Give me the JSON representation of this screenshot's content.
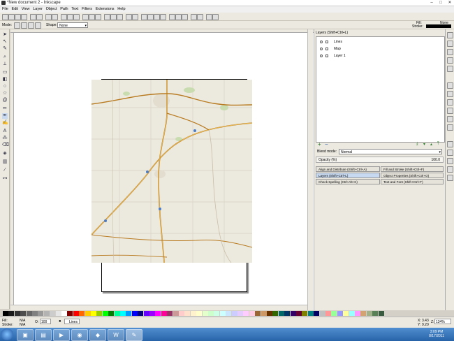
{
  "window": {
    "title": "*New document 2 - Inkscape"
  },
  "menu": [
    "File",
    "Edit",
    "View",
    "Layer",
    "Object",
    "Path",
    "Text",
    "Filters",
    "Extensions",
    "Help"
  ],
  "controls": {
    "mode_label": "Mode:",
    "shape_label": "Shape:",
    "shape_value": "None"
  },
  "fill_stroke": {
    "fill_label": "Fill:",
    "fill_value": "None",
    "stroke_label": "Stroke:"
  },
  "layers_panel": {
    "title": "Layers (Shift+Ctrl+L)",
    "layers": [
      {
        "name": "Lines"
      },
      {
        "name": "Map"
      },
      {
        "name": "Layer 1"
      }
    ],
    "blend_label": "Blend mode:",
    "blend_value": "Normal",
    "opacity_label": "Opacity (%)",
    "opacity_value": "100.0"
  },
  "docks": [
    "Align and Distribute (Shift+Ctrl+A)",
    "Fill and Stroke (Shift+Ctrl+F)",
    "Layers (Shift+Ctrl+L)",
    "Object Properties (Shift+Ctrl+O)",
    "Check Spelling (Ctrl+Alt+K)",
    "Text and Font (Shift+Ctrl+T)"
  ],
  "status": {
    "fill_label": "Fill:",
    "fill_value": "N/A",
    "stroke_label": "Stroke:",
    "stroke_value": "N/A",
    "opacity_label": "O:",
    "opacity_value": "100",
    "layer_value": "Lines",
    "x_label": "X:",
    "x_value": "3.43",
    "y_label": "Y:",
    "y_value": "9.20",
    "zoom_label": "Z:",
    "zoom_value": "134%"
  },
  "clock": {
    "time": "3:09 PM",
    "date": "8/17/2011"
  },
  "palette_colors": [
    "#000000",
    "#1a1a1a",
    "#333333",
    "#4d4d4d",
    "#666666",
    "#808080",
    "#999999",
    "#b3b3b3",
    "#cccccc",
    "#e6e6e6",
    "#ffffff",
    "#800000",
    "#ff0000",
    "#ff6600",
    "#ffcc00",
    "#ffff00",
    "#99cc00",
    "#00ff00",
    "#008000",
    "#00ff99",
    "#00ffff",
    "#0099ff",
    "#0000ff",
    "#000080",
    "#6600ff",
    "#9900ff",
    "#ff00ff",
    "#ff0099",
    "#993366",
    "#cc9999",
    "#ffcccc",
    "#ffe0cc",
    "#fff2cc",
    "#ffffcc",
    "#e5ffcc",
    "#ccffcc",
    "#ccffe5",
    "#ccffff",
    "#cce5ff",
    "#ccccff",
    "#e5ccff",
    "#ffccff",
    "#ffcce5",
    "#996633",
    "#cc9966",
    "#663300",
    "#336600",
    "#006666",
    "#003366",
    "#330066",
    "#660033",
    "#808000",
    "#008080",
    "#000066",
    "#c0c0c0",
    "#ff9999",
    "#99ff99",
    "#9999ff",
    "#ffff99",
    "#99ffff",
    "#ff99ff",
    "#d4a373",
    "#a3b18a",
    "#588157",
    "#3a5a40"
  ]
}
